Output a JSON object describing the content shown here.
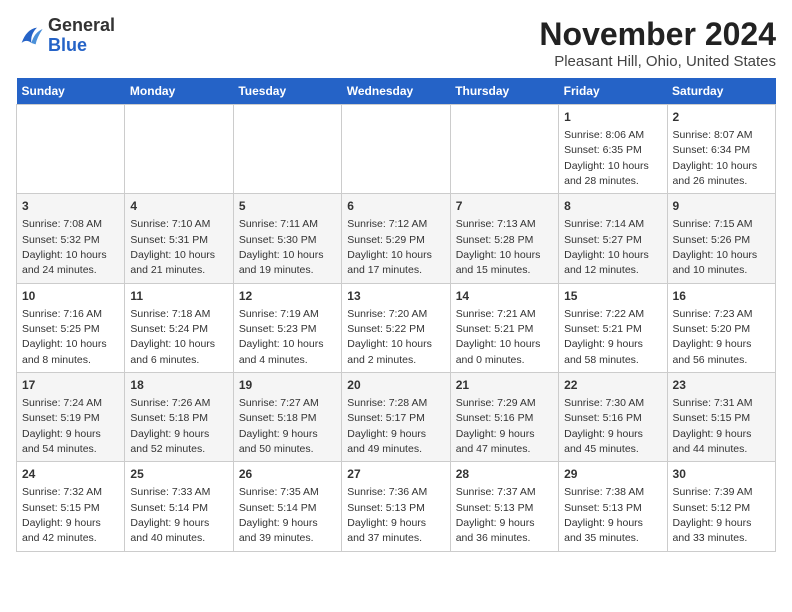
{
  "logo": {
    "general": "General",
    "blue": "Blue"
  },
  "title": "November 2024",
  "subtitle": "Pleasant Hill, Ohio, United States",
  "days_of_week": [
    "Sunday",
    "Monday",
    "Tuesday",
    "Wednesday",
    "Thursday",
    "Friday",
    "Saturday"
  ],
  "weeks": [
    [
      {
        "day": "",
        "info": ""
      },
      {
        "day": "",
        "info": ""
      },
      {
        "day": "",
        "info": ""
      },
      {
        "day": "",
        "info": ""
      },
      {
        "day": "",
        "info": ""
      },
      {
        "day": "1",
        "info": "Sunrise: 8:06 AM\nSunset: 6:35 PM\nDaylight: 10 hours and 28 minutes."
      },
      {
        "day": "2",
        "info": "Sunrise: 8:07 AM\nSunset: 6:34 PM\nDaylight: 10 hours and 26 minutes."
      }
    ],
    [
      {
        "day": "3",
        "info": "Sunrise: 7:08 AM\nSunset: 5:32 PM\nDaylight: 10 hours and 24 minutes."
      },
      {
        "day": "4",
        "info": "Sunrise: 7:10 AM\nSunset: 5:31 PM\nDaylight: 10 hours and 21 minutes."
      },
      {
        "day": "5",
        "info": "Sunrise: 7:11 AM\nSunset: 5:30 PM\nDaylight: 10 hours and 19 minutes."
      },
      {
        "day": "6",
        "info": "Sunrise: 7:12 AM\nSunset: 5:29 PM\nDaylight: 10 hours and 17 minutes."
      },
      {
        "day": "7",
        "info": "Sunrise: 7:13 AM\nSunset: 5:28 PM\nDaylight: 10 hours and 15 minutes."
      },
      {
        "day": "8",
        "info": "Sunrise: 7:14 AM\nSunset: 5:27 PM\nDaylight: 10 hours and 12 minutes."
      },
      {
        "day": "9",
        "info": "Sunrise: 7:15 AM\nSunset: 5:26 PM\nDaylight: 10 hours and 10 minutes."
      }
    ],
    [
      {
        "day": "10",
        "info": "Sunrise: 7:16 AM\nSunset: 5:25 PM\nDaylight: 10 hours and 8 minutes."
      },
      {
        "day": "11",
        "info": "Sunrise: 7:18 AM\nSunset: 5:24 PM\nDaylight: 10 hours and 6 minutes."
      },
      {
        "day": "12",
        "info": "Sunrise: 7:19 AM\nSunset: 5:23 PM\nDaylight: 10 hours and 4 minutes."
      },
      {
        "day": "13",
        "info": "Sunrise: 7:20 AM\nSunset: 5:22 PM\nDaylight: 10 hours and 2 minutes."
      },
      {
        "day": "14",
        "info": "Sunrise: 7:21 AM\nSunset: 5:21 PM\nDaylight: 10 hours and 0 minutes."
      },
      {
        "day": "15",
        "info": "Sunrise: 7:22 AM\nSunset: 5:21 PM\nDaylight: 9 hours and 58 minutes."
      },
      {
        "day": "16",
        "info": "Sunrise: 7:23 AM\nSunset: 5:20 PM\nDaylight: 9 hours and 56 minutes."
      }
    ],
    [
      {
        "day": "17",
        "info": "Sunrise: 7:24 AM\nSunset: 5:19 PM\nDaylight: 9 hours and 54 minutes."
      },
      {
        "day": "18",
        "info": "Sunrise: 7:26 AM\nSunset: 5:18 PM\nDaylight: 9 hours and 52 minutes."
      },
      {
        "day": "19",
        "info": "Sunrise: 7:27 AM\nSunset: 5:18 PM\nDaylight: 9 hours and 50 minutes."
      },
      {
        "day": "20",
        "info": "Sunrise: 7:28 AM\nSunset: 5:17 PM\nDaylight: 9 hours and 49 minutes."
      },
      {
        "day": "21",
        "info": "Sunrise: 7:29 AM\nSunset: 5:16 PM\nDaylight: 9 hours and 47 minutes."
      },
      {
        "day": "22",
        "info": "Sunrise: 7:30 AM\nSunset: 5:16 PM\nDaylight: 9 hours and 45 minutes."
      },
      {
        "day": "23",
        "info": "Sunrise: 7:31 AM\nSunset: 5:15 PM\nDaylight: 9 hours and 44 minutes."
      }
    ],
    [
      {
        "day": "24",
        "info": "Sunrise: 7:32 AM\nSunset: 5:15 PM\nDaylight: 9 hours and 42 minutes."
      },
      {
        "day": "25",
        "info": "Sunrise: 7:33 AM\nSunset: 5:14 PM\nDaylight: 9 hours and 40 minutes."
      },
      {
        "day": "26",
        "info": "Sunrise: 7:35 AM\nSunset: 5:14 PM\nDaylight: 9 hours and 39 minutes."
      },
      {
        "day": "27",
        "info": "Sunrise: 7:36 AM\nSunset: 5:13 PM\nDaylight: 9 hours and 37 minutes."
      },
      {
        "day": "28",
        "info": "Sunrise: 7:37 AM\nSunset: 5:13 PM\nDaylight: 9 hours and 36 minutes."
      },
      {
        "day": "29",
        "info": "Sunrise: 7:38 AM\nSunset: 5:13 PM\nDaylight: 9 hours and 35 minutes."
      },
      {
        "day": "30",
        "info": "Sunrise: 7:39 AM\nSunset: 5:12 PM\nDaylight: 9 hours and 33 minutes."
      }
    ]
  ]
}
